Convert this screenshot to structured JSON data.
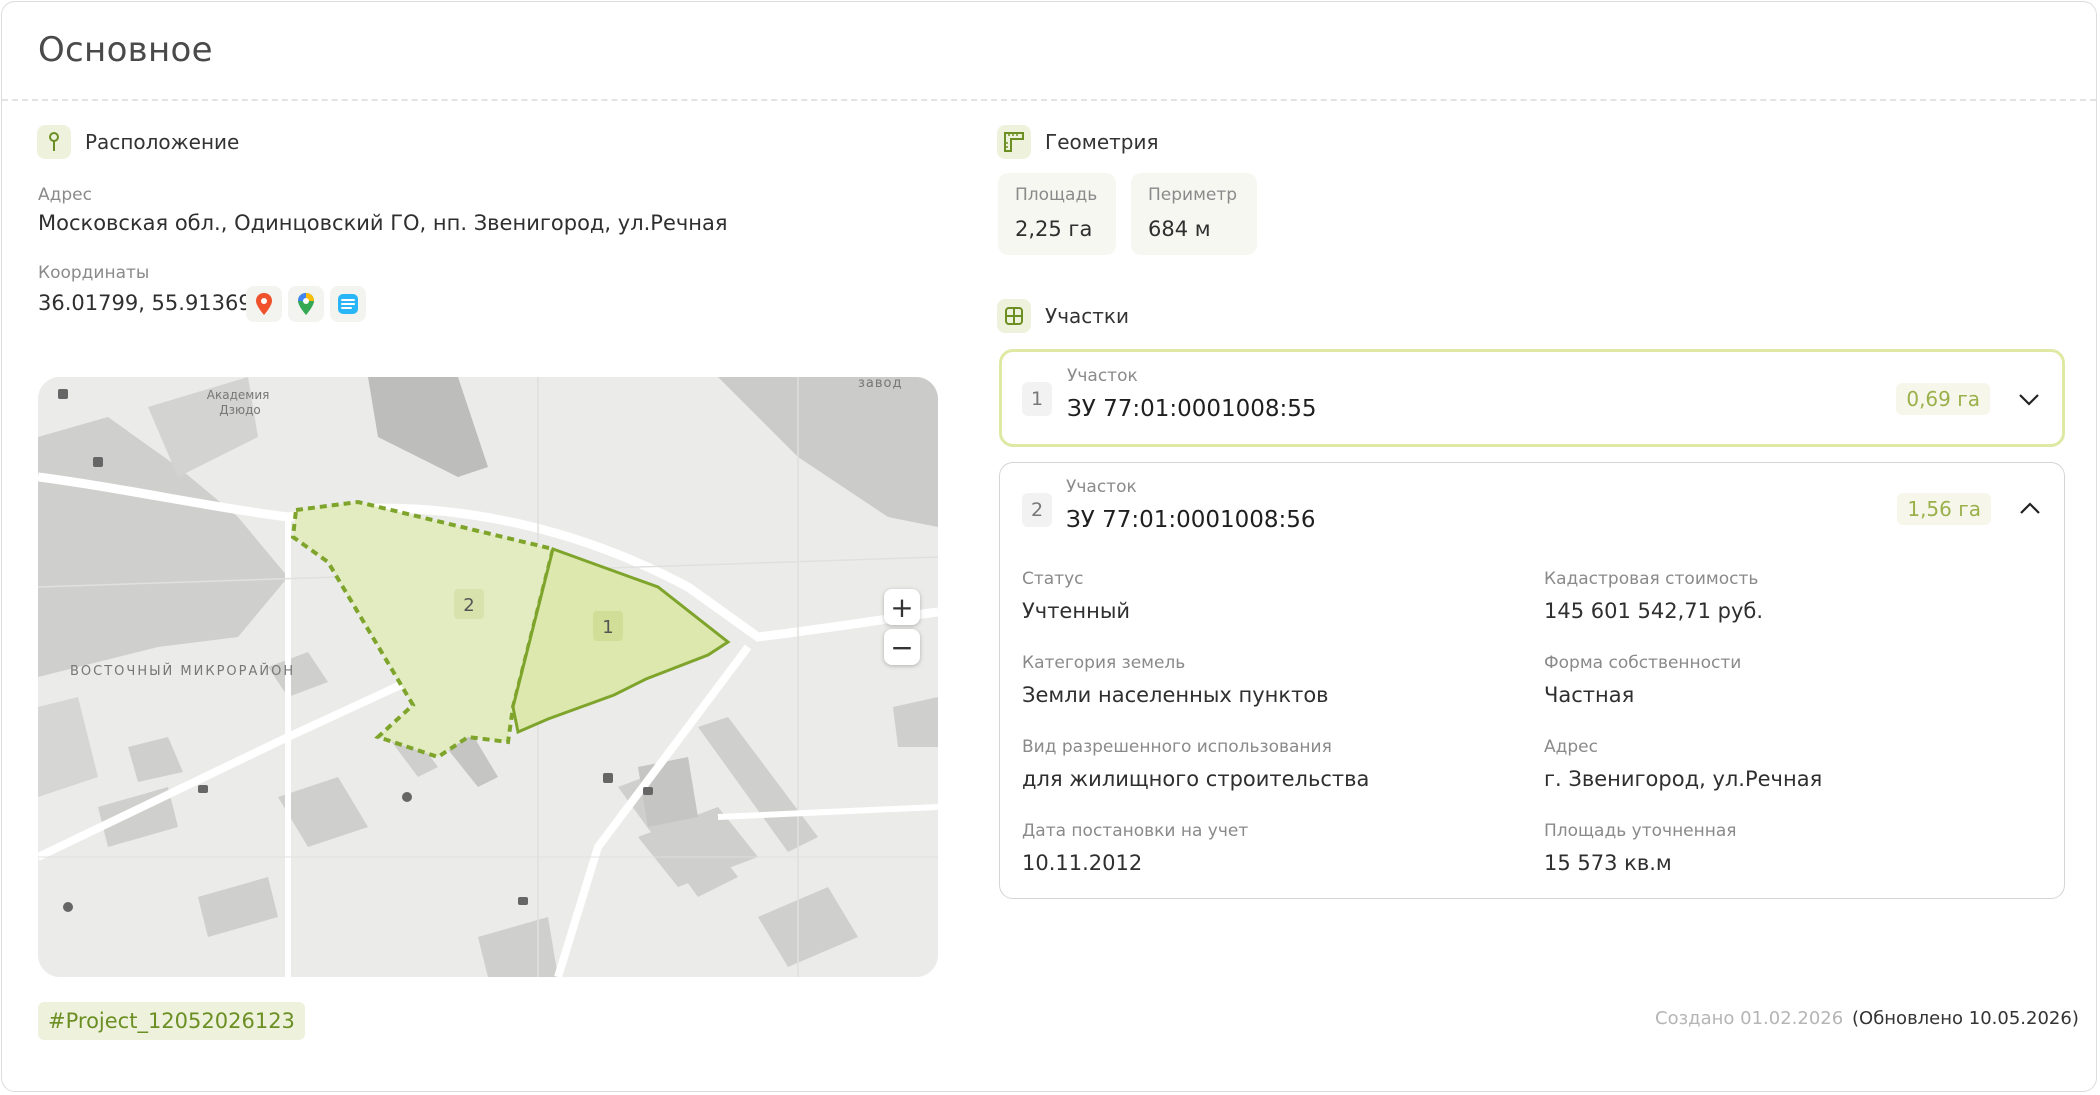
{
  "page": {
    "title": "Основное"
  },
  "location": {
    "heading": "Расположение",
    "address_label": "Адрес",
    "address": "Московская обл., Одинцовский ГО, нп. Звенигород, ул.Речная",
    "coords_label": "Координаты",
    "coords": "36.01799, 55.913697",
    "coord_icons": [
      "yandex-maps-icon",
      "google-maps-icon",
      "2gis-icon"
    ]
  },
  "map": {
    "labels": {
      "academy": "Академия\nДзюдо",
      "factory": "завод",
      "district": "ВОСТОЧНЫЙ МИКРОРАЙОН",
      "parcel1": "1",
      "parcel2": "2"
    },
    "zoom_in": "+",
    "zoom_out": "−"
  },
  "project_tag": "#Project_12052026123",
  "created": "Создано 01.02.2026",
  "updated": "(Обновлено 10.05.2026)",
  "geometry": {
    "heading": "Геометрия",
    "area_label": "Площадь",
    "area": "2,25 га",
    "perimeter_label": "Периметр",
    "perimeter": "684 м"
  },
  "parcels": {
    "heading": "Участки",
    "items": [
      {
        "num": "1",
        "label": "Участок",
        "title": "ЗУ 77:01:0001008:55",
        "area": "0,69 га",
        "expanded": false
      },
      {
        "num": "2",
        "label": "Участок",
        "title": "ЗУ 77:01:0001008:56",
        "area": "1,56 га",
        "expanded": true,
        "details": [
          {
            "label": "Статус",
            "value": "Учтенный"
          },
          {
            "label": "Кадастровая стоимость",
            "value": "145 601 542,71 руб."
          },
          {
            "label": "Категория земель",
            "value": "Земли населенных пунктов"
          },
          {
            "label": "Форма собственности",
            "value": "Частная"
          },
          {
            "label": "Вид разрешенного использования",
            "value": "для жилищного строительства"
          },
          {
            "label": "Адрес",
            "value": "г. Звенигород, ул.Речная"
          },
          {
            "label": "Дата постановки на учет",
            "value": "10.11.2012"
          },
          {
            "label": "Площадь уточненная",
            "value": "15 573 кв.м"
          }
        ]
      }
    ]
  },
  "colors": {
    "accent": "#6b8f23",
    "accent_light": "#eef2dd",
    "parcel_fill": "#e2ecc0",
    "parcel_stroke": "#7ea42c"
  }
}
